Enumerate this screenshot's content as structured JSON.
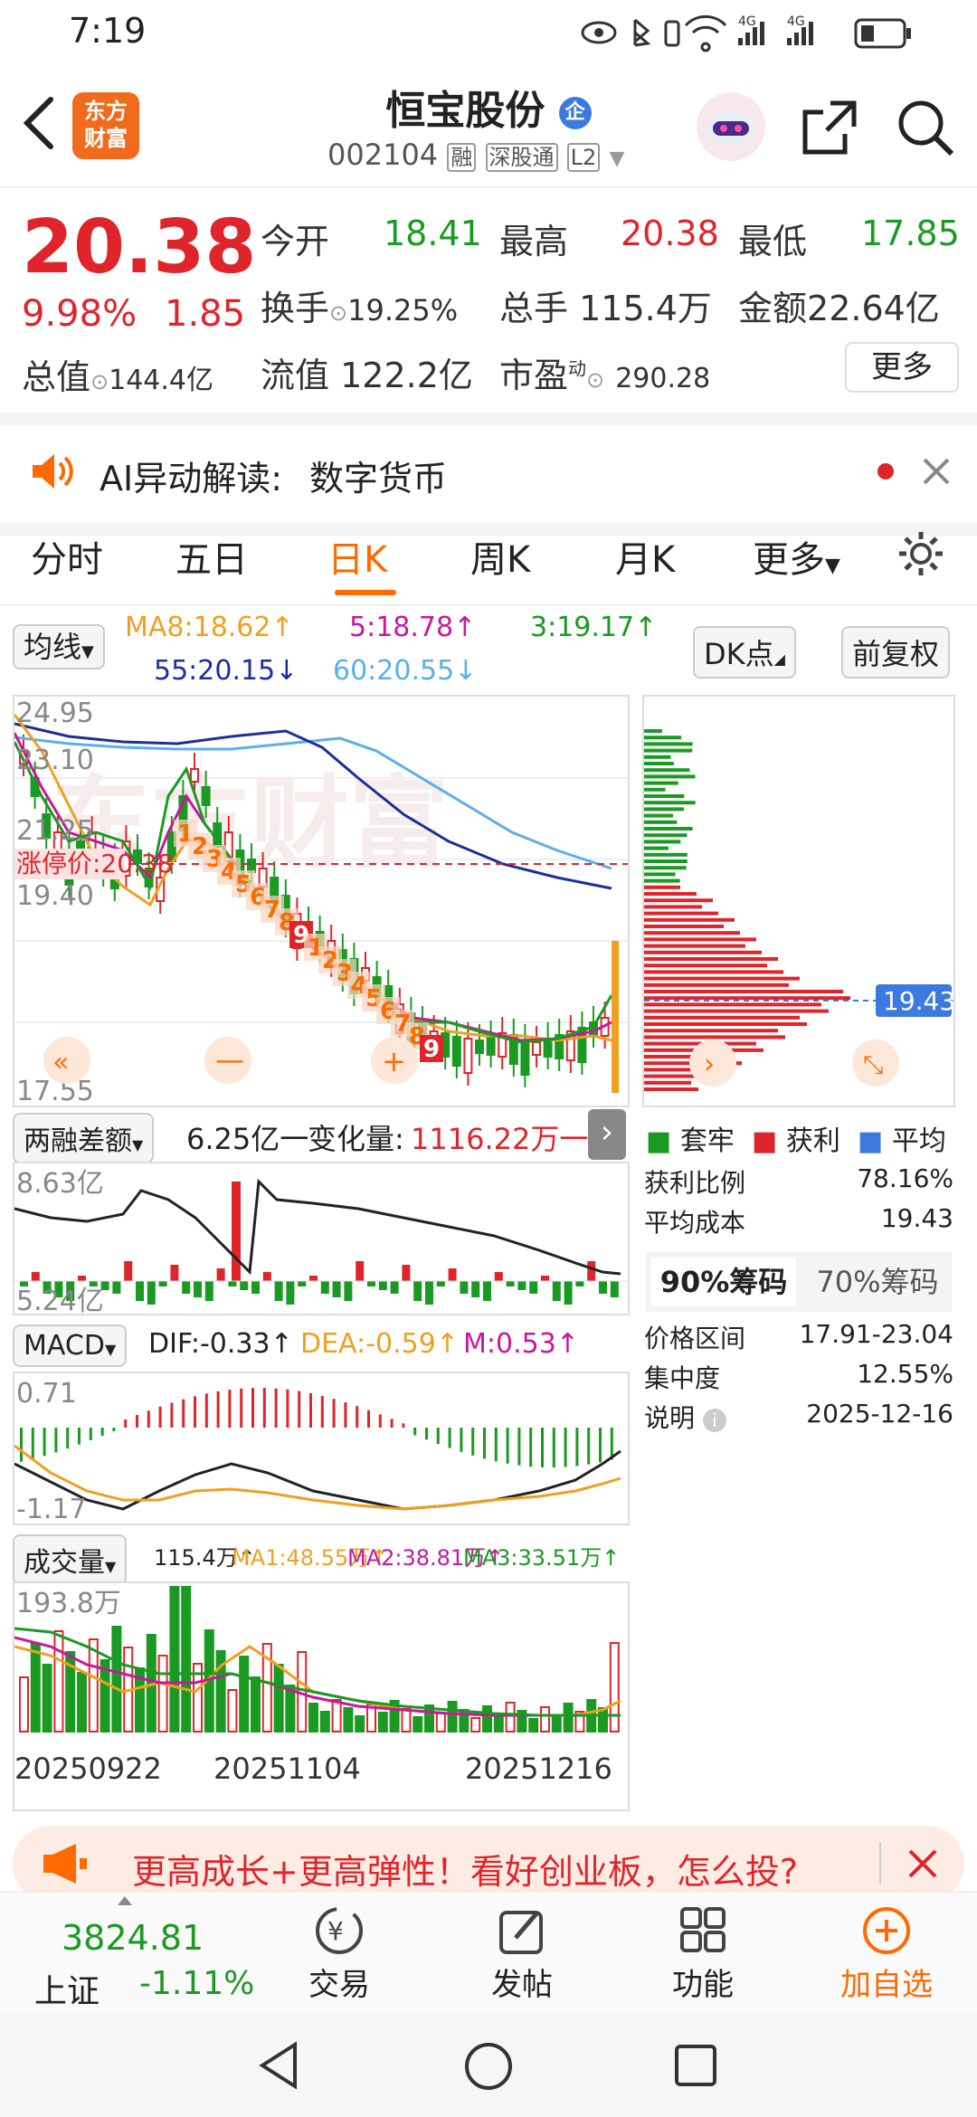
{
  "status": {
    "time": "7:19",
    "net1": "4G",
    "net2": "4G"
  },
  "header": {
    "logo_line1": "东方",
    "logo_line2": "财富",
    "stock_name": "恒宝股份",
    "name_badge": "企",
    "code": "002104",
    "tag1": "融",
    "tag2": "深股通",
    "tag3": "L2"
  },
  "quote": {
    "price": "20.38",
    "change_pct": "9.98%",
    "change": "1.85",
    "open_label": "今开",
    "open": "18.41",
    "high_label": "最高",
    "high": "20.38",
    "low_label": "最低",
    "low": "17.85",
    "turnover_label": "换手",
    "turnover": "19.25%",
    "volume_label": "总手",
    "volume": "115.4万",
    "amount_label": "金额",
    "amount": "22.64亿",
    "mktcap_label": "总值",
    "mktcap": "144.4亿",
    "float_label": "流值",
    "float_cap": "122.2亿",
    "pe_label": "市盈",
    "pe_sup": "动",
    "pe": "290.28",
    "more_btn": "更多"
  },
  "ai": {
    "label": "AI异动解读:",
    "topic": "数字货币"
  },
  "tabs": [
    "分时",
    "五日",
    "日K",
    "周K",
    "月K",
    "更多"
  ],
  "tab_active_index": 2,
  "kline": {
    "ma_selector": "均线",
    "ma8": "MA8:18.62↑",
    "ma5": "5:18.78↑",
    "ma3": "3:19.17↑",
    "ma55": "55:20.15↓",
    "ma60": "60:20.55↓",
    "dk_btn": "DK点",
    "fq_btn": "前复权",
    "y_labels": [
      "24.95",
      "23.10",
      "21.25",
      "19.40",
      "17.55"
    ],
    "limit_label": "涨停价:20.38",
    "nine_labels": [
      "1",
      "2",
      "3",
      "4",
      "5",
      "6",
      "7",
      "8",
      "9",
      "1",
      "2",
      "3",
      "4",
      "5",
      "6",
      "7",
      "8",
      "9"
    ]
  },
  "chips": {
    "cost_tag": "19.43",
    "legend_trap": "套牢",
    "legend_profit": "获利",
    "legend_avg": "平均",
    "profit_ratio_label": "获利比例",
    "profit_ratio": "78.16%",
    "avg_cost_label": "平均成本",
    "avg_cost": "19.43",
    "tab90": "90%筹码",
    "tab70": "70%筹码",
    "range_label": "价格区间",
    "range": "17.91-23.04",
    "concentration_label": "集中度",
    "concentration": "12.55%",
    "note_label": "说明",
    "note_date": "2025-12-16"
  },
  "margin": {
    "selector": "两融差额",
    "value": "6.25亿一",
    "change_label": "变化量:",
    "change": "1116.22万一",
    "y_top": "8.63亿",
    "y_bottom": "5.24亿"
  },
  "macd": {
    "selector": "MACD",
    "dif": "DIF:-0.33↑",
    "dea": "DEA:-0.59↑",
    "m": "M:0.53↑",
    "y_top": "0.71",
    "y_bottom": "-1.17"
  },
  "vol": {
    "selector": "成交量",
    "value": "115.4万↑",
    "ma1": "MA1:48.55万↑",
    "ma2": "MA2:38.81万↑",
    "ma3": "MA3:33.51万↑",
    "y_top": "193.8万",
    "dates": [
      "20250922",
      "20251104",
      "20251216"
    ]
  },
  "ad": {
    "text": "更高成长+更高弹性！看好创业板，怎么投?"
  },
  "bottom": {
    "index_value": "3824.81",
    "index_name": "上证",
    "index_change": "-1.11%",
    "trade": "交易",
    "post": "发帖",
    "func": "功能",
    "add": "加自选"
  },
  "colors": {
    "up": "#e0242b",
    "down": "#1a9a22",
    "accent": "#ff6a00",
    "ma8": "#f0a020",
    "ma5": "#c8189c",
    "ma55": "#1c2f9a",
    "ma60": "#5ab0e8"
  }
}
